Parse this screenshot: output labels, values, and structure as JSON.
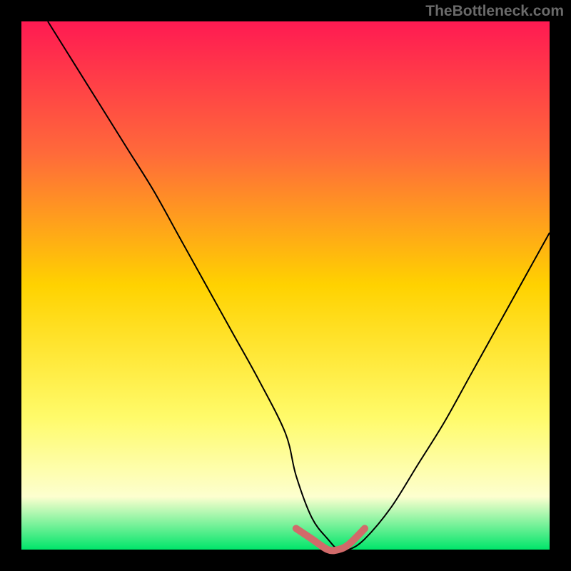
{
  "watermark": "TheBottleneck.com",
  "chart_data": {
    "type": "line",
    "title": "",
    "xlabel": "",
    "ylabel": "",
    "xlim": [
      0,
      100
    ],
    "ylim": [
      0,
      100
    ],
    "series": [
      {
        "name": "bottleneck-curve",
        "x": [
          5,
          10,
          15,
          20,
          25,
          30,
          35,
          40,
          45,
          50,
          52,
          55,
          58,
          60,
          62,
          65,
          70,
          75,
          80,
          85,
          90,
          95,
          100
        ],
        "y": [
          100,
          92,
          84,
          76,
          68,
          59,
          50,
          41,
          32,
          22,
          14,
          6,
          2,
          0,
          0,
          2,
          8,
          16,
          24,
          33,
          42,
          51,
          60
        ]
      },
      {
        "name": "optimal-band",
        "x": [
          52,
          55,
          58,
          60,
          62,
          65
        ],
        "y": [
          4,
          2,
          0,
          0,
          1,
          4
        ]
      }
    ],
    "gradient_stops": [
      {
        "offset": 0,
        "color": "#ff1a52"
      },
      {
        "offset": 25,
        "color": "#ff6a3a"
      },
      {
        "offset": 50,
        "color": "#ffd200"
      },
      {
        "offset": 75,
        "color": "#fffb6a"
      },
      {
        "offset": 90,
        "color": "#fdffcf"
      },
      {
        "offset": 100,
        "color": "#00e56a"
      }
    ],
    "accent_color": "#d16a6a",
    "curve_color": "#000000"
  }
}
